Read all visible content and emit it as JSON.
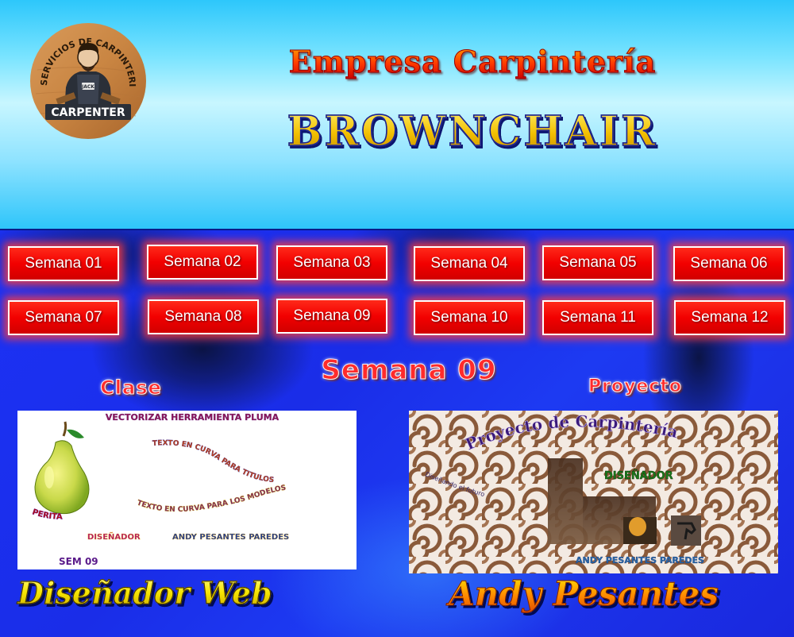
{
  "header": {
    "logo": {
      "icon": "carpenter-logo-icon",
      "arc_text": "SERVICIOS DE CARPINTERIA",
      "apron_text": "JACK",
      "banner_text": "CARPENTER"
    },
    "title_line1": "Empresa Carpintería",
    "title_line2": "BROWNCHAIR"
  },
  "nav": {
    "buttons": [
      "Semana 01",
      "Semana 02",
      "Semana 03",
      "Semana 04",
      "Semana 05",
      "Semana 06",
      "Semana 07",
      "Semana 08",
      "Semana 09",
      "Semana 10",
      "Semana 11",
      "Semana 12"
    ]
  },
  "content": {
    "week_title": "Semana 09",
    "clase_label": "Clase",
    "proyecto_label": "Proyecto",
    "clase_image": {
      "heading": "VECTORIZAR HERRAMIENTA PLUMA",
      "curve_text_1": "TEXTO EN CURVA PARA TITULOS",
      "curve_text_2": "TEXTO EN CURVA PARA LOS MODELOS",
      "pear_label": "PERITA",
      "designer_label": "DISEÑADOR",
      "designer_name": "ANDY PESANTES PAREDES",
      "sem_label": "SEM 09"
    },
    "proyecto_image": {
      "arc_title": "Proyecto de Carpintería",
      "small_arc_text": "Diseñando el futuro",
      "designer_label": "DISEÑADOR",
      "designer_name": "ANDY PESANTES PAREDES"
    }
  },
  "footer": {
    "left": "Diseñador Web",
    "right": "Andy Pesantes"
  },
  "colors": {
    "header_top": "#2dc7fb",
    "header_mid": "#c8f6ff",
    "main_blue": "#1c32f5",
    "button_red": "#f20000",
    "title_red": "#ff2b2b",
    "gold": "#f2bf00"
  }
}
